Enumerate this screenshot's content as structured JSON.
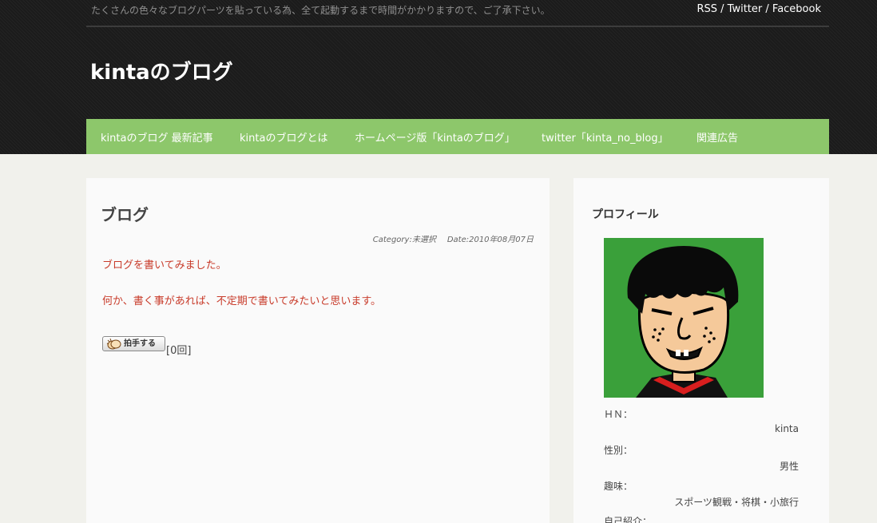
{
  "header": {
    "notice": "たくさんの色々なブログパーツを貼っている為、全て起動するまで時間がかかりますので、ご了承下さい。",
    "feeds": {
      "rss": "RSS",
      "twitter": "Twitter",
      "facebook": "Facebook",
      "separator": " / "
    },
    "site_title": "kintaのブログ"
  },
  "nav": {
    "items": [
      {
        "label": "kintaのブログ 最新記事"
      },
      {
        "label": "kintaのブログとは"
      },
      {
        "label": "ホームページ版「kintaのブログ」"
      },
      {
        "label": "twitter「kinta_no_blog」"
      },
      {
        "label": "関連広告"
      }
    ]
  },
  "post": {
    "title": "ブログ",
    "category": "Category:未選択",
    "date": "Date:2010年08月07日",
    "lines": [
      "ブログを書いてみました。",
      "何か、書く事があれば、不定期で書いてみたいと思います。"
    ],
    "clap_button": "拍手する",
    "clap_count": "[0回]"
  },
  "sidebar": {
    "widget_title": "プロフィール",
    "profile": {
      "hn_label": "ＨＮ：",
      "hn_value": "kinta",
      "gender_label": "性別：",
      "gender_value": "男性",
      "hobby_label": "趣味：",
      "hobby_value": "スポーツ観戦・将棋・小旅行",
      "intro_label": "自己紹介："
    }
  },
  "colors": {
    "nav_green": "#8dc76b",
    "post_text_red": "#c83b2a",
    "header_dark": "#1b1b1b"
  }
}
